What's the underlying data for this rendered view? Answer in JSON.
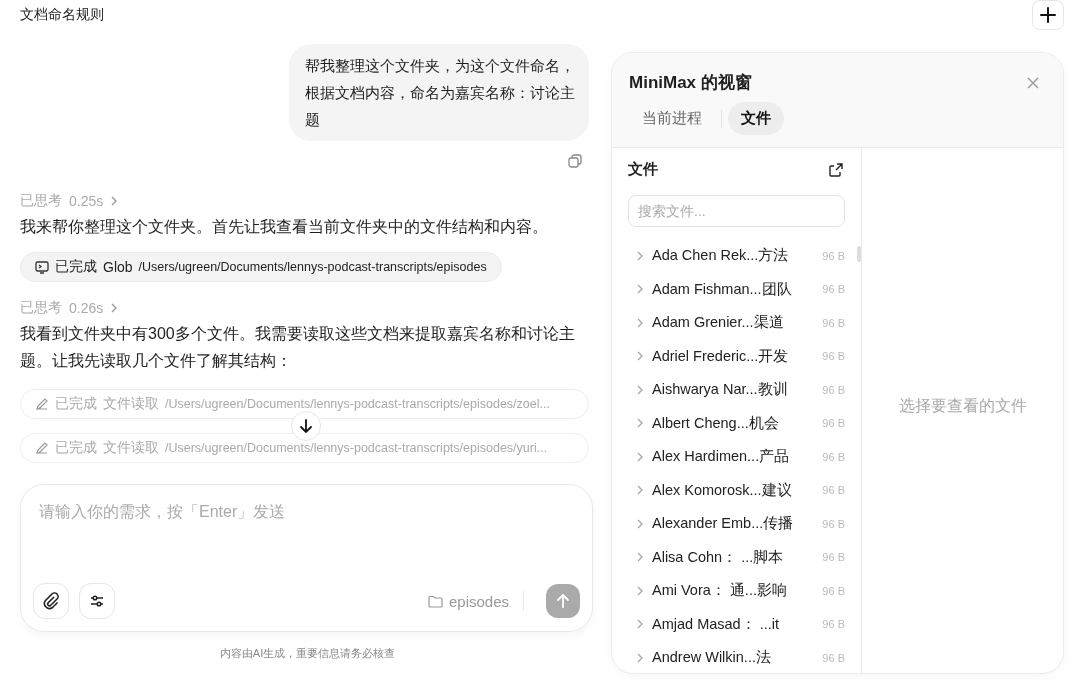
{
  "page_title": "文档命名规则",
  "chat": {
    "user_message": "帮我整理这个文件夹，为这个文件命名，根据文档内容，命名为嘉宾名称：讨论主题",
    "messages": [
      {
        "kind": "thinking",
        "label": "已思考",
        "time": "0.25s"
      },
      {
        "kind": "text",
        "text": "我来帮你整理这个文件夹。首先让我查看当前文件夹中的文件结构和内容。"
      },
      {
        "kind": "command",
        "status": "已完成",
        "tool": "Glob",
        "path": "/Users/ugreen/Documents/lennys-podcast-transcripts/episodes"
      },
      {
        "kind": "thinking",
        "label": "已思考",
        "time": "0.26s"
      },
      {
        "kind": "text",
        "text": "我看到文件夹中有300多个文件。我需要读取这些文档来提取嘉宾名称和讨论主题。让我先读取几个文件了解其结构："
      },
      {
        "kind": "file_read",
        "status": "已完成",
        "tool": "文件读取",
        "path": "/Users/ugreen/Documents/lennys-podcast-transcripts/episodes/zoel..."
      },
      {
        "kind": "file_read",
        "status": "已完成",
        "tool": "文件读取",
        "path": "/Users/ugreen/Documents/lennys-podcast-transcripts/episodes/yuri..."
      }
    ],
    "input": {
      "placeholder": "请输入你的需求，按「Enter」发送",
      "folder": "episodes"
    },
    "footer_note": "内容由AI生成，重要信息请务必核查"
  },
  "panel": {
    "title": "MiniMax 的视窗",
    "tabs": [
      {
        "label": "当前进程",
        "selected": false
      },
      {
        "label": "文件",
        "selected": true
      }
    ],
    "files_heading": "文件",
    "search_placeholder": "搜索文件...",
    "files": [
      {
        "name": "Ada Chen Rek...方法",
        "size": "96 B"
      },
      {
        "name": "Adam Fishman...团队",
        "size": "96 B"
      },
      {
        "name": "Adam Grenier...渠道",
        "size": "96 B"
      },
      {
        "name": "Adriel Frederic...开发",
        "size": "96 B"
      },
      {
        "name": "Aishwarya Nar...教训",
        "size": "96 B"
      },
      {
        "name": "Albert Cheng...机会",
        "size": "96 B"
      },
      {
        "name": "Alex Hardimen...产品",
        "size": "96 B"
      },
      {
        "name": "Alex Komorosk...建议",
        "size": "96 B"
      },
      {
        "name": "Alexander Emb...传播",
        "size": "96 B"
      },
      {
        "name": "Alisa Cohn：  ...脚本",
        "size": "96 B"
      },
      {
        "name": "Ami Vora：  通...影响",
        "size": "96 B"
      },
      {
        "name": "Amjad Masad：  ...it",
        "size": "96 B"
      },
      {
        "name": "Andrew Wilkin...法",
        "size": "96 B"
      }
    ],
    "empty_hint": "选择要查看的文件"
  }
}
